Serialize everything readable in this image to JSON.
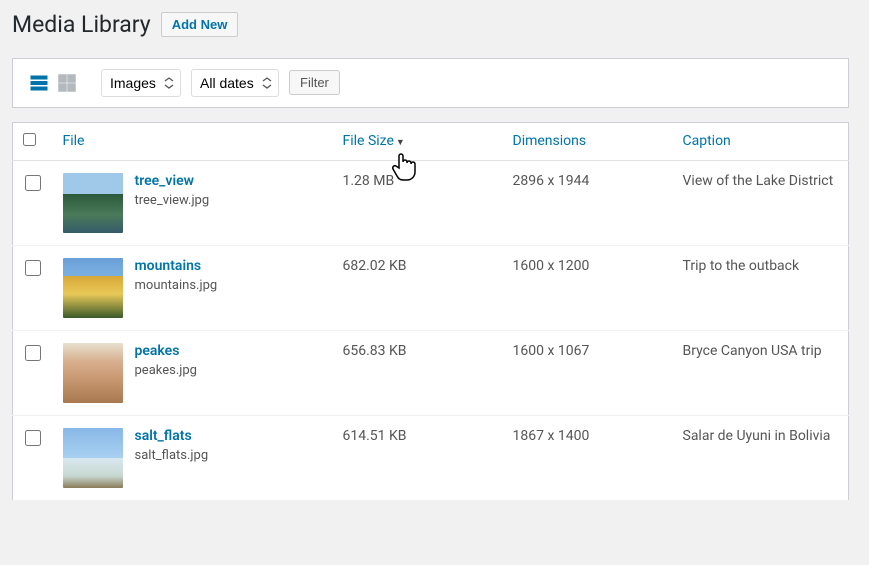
{
  "header": {
    "title": "Media Library",
    "add_new": "Add New"
  },
  "toolbar": {
    "type_filter": "Images",
    "date_filter": "All dates",
    "filter_btn": "Filter"
  },
  "columns": {
    "file": "File",
    "size": "File Size",
    "dimensions": "Dimensions",
    "caption": "Caption"
  },
  "rows": [
    {
      "title": "tree_view",
      "filename": "tree_view.jpg",
      "size": "1.28 MB",
      "dimensions": "2896 x 1944",
      "caption": "View of the Lake District",
      "thumb": "thumb-tree"
    },
    {
      "title": "mountains",
      "filename": "mountains.jpg",
      "size": "682.02 KB",
      "dimensions": "1600 x 1200",
      "caption": "Trip to the outback",
      "thumb": "thumb-mtn"
    },
    {
      "title": "peakes",
      "filename": "peakes.jpg",
      "size": "656.83 KB",
      "dimensions": "1600 x 1067",
      "caption": "Bryce Canyon USA trip",
      "thumb": "thumb-peak"
    },
    {
      "title": "salt_flats",
      "filename": "salt_flats.jpg",
      "size": "614.51 KB",
      "dimensions": "1867 x 1400",
      "caption": "Salar de Uyuni in Bolivia",
      "thumb": "thumb-salt"
    }
  ]
}
